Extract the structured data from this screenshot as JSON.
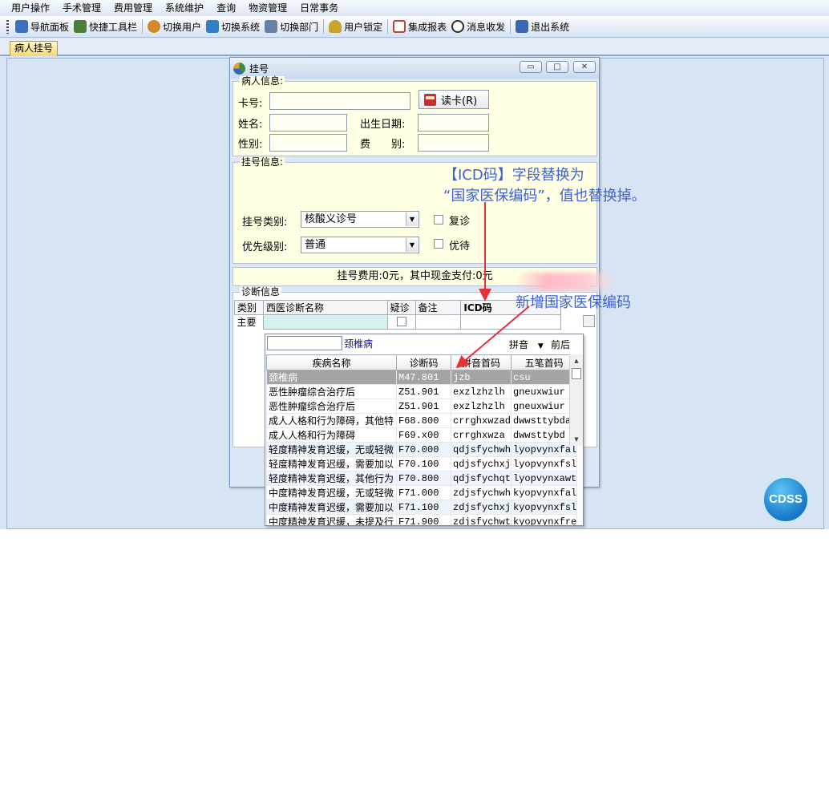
{
  "menu": [
    "用户操作",
    "手术管理",
    "费用管理",
    "系统维护",
    "查询",
    "物资管理",
    "日常事务"
  ],
  "toolbar": [
    {
      "label": "导航面板",
      "icon": "navigation-panel-icon",
      "color": "#3c6fbf"
    },
    {
      "label": "快捷工具栏",
      "icon": "quick-toolbar-icon",
      "color": "#4a7f3b"
    },
    {
      "label": "切换用户",
      "icon": "switch-user-icon",
      "color": "#d08a2a"
    },
    {
      "label": "切换系统",
      "icon": "switch-system-icon",
      "color": "#2f7fc9"
    },
    {
      "label": "切换部门",
      "icon": "switch-department-icon",
      "color": "#6b7fa3"
    },
    {
      "label": "用户锁定",
      "icon": "user-lock-icon",
      "color": "#c8a42b"
    },
    {
      "label": "集成报表",
      "icon": "integrated-report-icon",
      "color": "#b5463c"
    },
    {
      "label": "消息收发",
      "icon": "message-icon",
      "color": "#2c2c2c"
    },
    {
      "label": "退出系统",
      "icon": "exit-system-icon",
      "color": "#3a66b2"
    }
  ],
  "tab": {
    "label": "病人挂号"
  },
  "dialog": {
    "title": "挂号",
    "patient": {
      "legend": "病人信息:",
      "card_label": "卡号:",
      "read_card_label": "读卡(R)",
      "name_label": "姓名:",
      "birth_label": "出生日期:",
      "gender_label": "性别:",
      "fee_type_label": "费　　别:"
    },
    "registration": {
      "legend": "挂号信息:",
      "type_label": "挂号类别:",
      "type_value": "核酸义诊号",
      "revisit_label": "复诊",
      "priority_label": "优先级别:",
      "priority_value": "普通",
      "vip_label": "优待"
    },
    "fee_summary": "挂号费用:0元，其中现金支付:0元",
    "diagnosis": {
      "legend": "诊断信息",
      "columns": [
        "类别",
        "西医诊断名称",
        "疑诊",
        "备注",
        "ICD码"
      ],
      "row_type": "主要"
    }
  },
  "lookup": {
    "search_term": "颈椎病",
    "mode_option": "拼音",
    "match_option": "前后",
    "columns": [
      "疾病名称",
      "诊断码",
      "拼音首码",
      "五笔首码"
    ],
    "rows": [
      [
        "颈椎病",
        "M47.801",
        "jzb",
        "csu"
      ],
      [
        "恶性肿瘤综合治疗后",
        "Z51.901",
        "exzlzhzlh",
        "gneuxwiur"
      ],
      [
        "恶性肿瘤综合治疗后",
        "Z51.901",
        "exzlzhzlh",
        "gneuxwiur"
      ],
      [
        "成人人格和行为障碍，其他特",
        "F68.800",
        "crrghxwzad",
        "dwwsttybdaw"
      ],
      [
        "成人人格和行为障碍",
        "F69.x00",
        "crrghxwza",
        "dwwsttybd"
      ],
      [
        "轻度精神发育迟缓，无或轻微",
        "F70.000",
        "qdjsfychwh",
        "lyopvynxfal"
      ],
      [
        "轻度精神发育迟缓，需要加以",
        "F70.100",
        "qdjsfychxj",
        "lyopvynxfsl"
      ],
      [
        "轻度精神发育迟缓，其他行为",
        "F70.800",
        "qdjsfychqt",
        "lyopvynxawt"
      ],
      [
        "中度精神发育迟缓，无或轻微",
        "F71.000",
        "zdjsfychwh",
        "kyopvynxfal"
      ],
      [
        "中度精神发育迟缓，需要加以",
        "F71.100",
        "zdjsfychxj",
        "kyopvynxfsl"
      ],
      [
        "中度精神发育迟缓，未提及行",
        "F71.900",
        "zdjsfychwt",
        "kyopvynxfre"
      ]
    ]
  },
  "annotations": {
    "top_line1": "【ICD码】字段替换为",
    "top_line2": "“国家医保编码”，值也替换掉。",
    "bottom": "新增国家医保编码",
    "color": "#3e62d1",
    "arrow_color": "#e8303a"
  },
  "badge": {
    "label": "CDSS"
  }
}
